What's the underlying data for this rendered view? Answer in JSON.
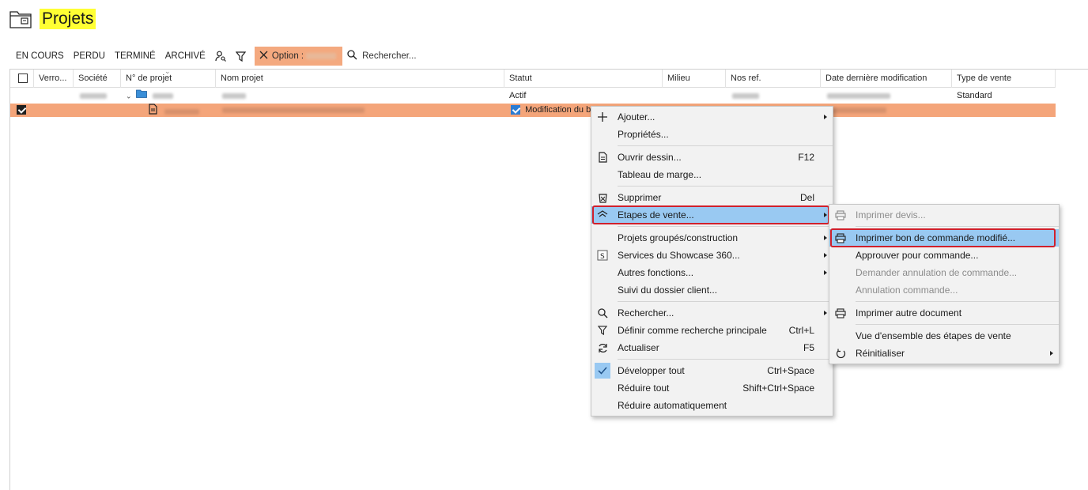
{
  "header": {
    "title": "Projets"
  },
  "toolbar": {
    "filters": [
      "EN COURS",
      "PERDU",
      "TERMINÉ",
      "ARCHIVÉ"
    ],
    "option_label": "Option :",
    "search_placeholder": "Rechercher..."
  },
  "grid": {
    "columns": [
      "Verro...",
      "Société",
      "N° de projet",
      "Nom projet",
      "Statut",
      "Milieu",
      "Nos ref.",
      "Date dernière modification",
      "Type de vente"
    ],
    "rows": [
      {
        "statut": "Actif",
        "type_de_vente": "Standard",
        "selected": false
      },
      {
        "statut": "Modification du b",
        "type_de_vente": "",
        "selected": true
      }
    ]
  },
  "context_menu": {
    "items": [
      {
        "label": "Ajouter...",
        "icon": "plus-icon",
        "shortcut": "",
        "submenu": true
      },
      {
        "label": "Propriétés...",
        "icon": "",
        "shortcut": "",
        "submenu": false
      },
      {
        "label": "Ouvrir dessin...",
        "icon": "open-drawing-icon",
        "shortcut": "F12",
        "submenu": false
      },
      {
        "label": "Tableau de marge...",
        "icon": "",
        "shortcut": "",
        "submenu": false
      },
      {
        "label": "Supprimer",
        "icon": "delete-icon",
        "shortcut": "Del",
        "submenu": false
      },
      {
        "label": "Etapes de vente...",
        "icon": "sales-steps-icon",
        "shortcut": "",
        "submenu": true
      },
      {
        "label": "Projets groupés/construction",
        "icon": "",
        "shortcut": "",
        "submenu": true
      },
      {
        "label": "Services du Showcase 360...",
        "icon": "showcase-icon",
        "shortcut": "",
        "submenu": true
      },
      {
        "label": "Autres fonctions...",
        "icon": "",
        "shortcut": "",
        "submenu": true
      },
      {
        "label": "Suivi du dossier client...",
        "icon": "",
        "shortcut": "",
        "submenu": false
      },
      {
        "label": "Rechercher...",
        "icon": "search-icon",
        "shortcut": "",
        "submenu": true
      },
      {
        "label": "Définir comme recherche principale",
        "icon": "filter-icon",
        "shortcut": "Ctrl+L",
        "submenu": false
      },
      {
        "label": "Actualiser",
        "icon": "refresh-icon",
        "shortcut": "F5",
        "submenu": false
      },
      {
        "label": "Développer tout",
        "icon": "check-icon",
        "shortcut": "Ctrl+Space",
        "submenu": false
      },
      {
        "label": "Réduire tout",
        "icon": "",
        "shortcut": "Shift+Ctrl+Space",
        "submenu": false
      },
      {
        "label": "Réduire automatiquement",
        "icon": "",
        "shortcut": "",
        "submenu": false
      }
    ]
  },
  "submenu": {
    "items": [
      {
        "label": "Imprimer devis...",
        "icon": "printer-icon",
        "disabled": true
      },
      {
        "label": "Imprimer bon de commande modifié...",
        "icon": "printer-icon",
        "disabled": false
      },
      {
        "label": "Approuver pour commande...",
        "icon": "",
        "disabled": false
      },
      {
        "label": "Demander annulation de commande...",
        "icon": "",
        "disabled": true
      },
      {
        "label": "Annulation commande...",
        "icon": "",
        "disabled": true
      },
      {
        "label": "Imprimer autre document",
        "icon": "printer-icon",
        "disabled": false
      },
      {
        "label": "Vue d'ensemble des étapes de vente",
        "icon": "",
        "disabled": false
      },
      {
        "label": "Réinitialiser",
        "icon": "reset-icon",
        "disabled": false
      }
    ]
  },
  "colors": {
    "title_highlight": "#ffff33",
    "selected_row": "#f4a57a",
    "menu_highlight": "#99c9f2",
    "focus_outline": "#d0202c"
  }
}
